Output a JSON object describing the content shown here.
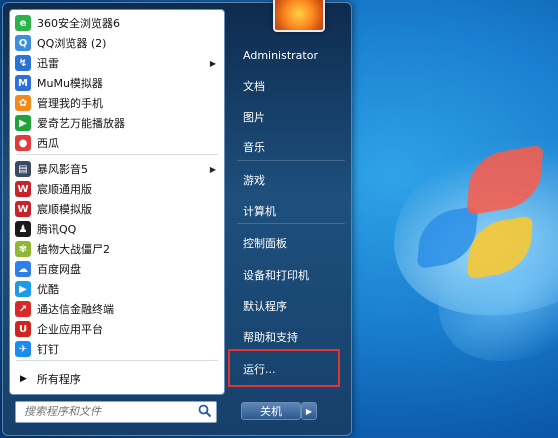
{
  "programs": [
    {
      "label": "360安全浏览器6",
      "icon": "360-browser-icon",
      "color": "#2db34a",
      "glyph": "e",
      "has_submenu": false
    },
    {
      "label": "QQ浏览器 (2)",
      "icon": "qq-browser-icon",
      "color": "#3b8de0",
      "glyph": "Q",
      "has_submenu": false
    },
    {
      "label": "迅雷",
      "icon": "xunlei-icon",
      "color": "#2a73d6",
      "glyph": "↯",
      "has_submenu": true
    },
    {
      "label": "MuMu模拟器",
      "icon": "mumu-icon",
      "color": "#2f6fd8",
      "glyph": "M",
      "has_submenu": false
    },
    {
      "label": "管理我的手机",
      "icon": "phone-manager-icon",
      "color": "#f08a1c",
      "glyph": "✿",
      "has_submenu": false
    },
    {
      "label": "爱奇艺万能播放器",
      "icon": "iqiyi-player-icon",
      "color": "#20a33a",
      "glyph": "▶",
      "has_submenu": false
    },
    {
      "label": "西瓜",
      "icon": "xigua-icon",
      "color": "#e23b3b",
      "glyph": "●",
      "has_submenu": false
    },
    {
      "label": "暴风影音5",
      "icon": "baofeng-icon",
      "color": "#3a4a64",
      "glyph": "▤",
      "has_submenu": true
    },
    {
      "label": "宸顺通用版",
      "icon": "chenshun-general-icon",
      "color": "#c8222b",
      "glyph": "W",
      "has_submenu": false
    },
    {
      "label": "宸顺模拟版",
      "icon": "chenshun-sim-icon",
      "color": "#c8222b",
      "glyph": "W",
      "has_submenu": false
    },
    {
      "label": "腾讯QQ",
      "icon": "qq-penguin-icon",
      "color": "#1a1a1a",
      "glyph": "♟",
      "has_submenu": false
    },
    {
      "label": "植物大战僵尸2",
      "icon": "pvz-icon",
      "color": "#8fb832",
      "glyph": "✾",
      "has_submenu": false
    },
    {
      "label": "百度网盘",
      "icon": "baidu-pan-icon",
      "color": "#2e7fe8",
      "glyph": "☁",
      "has_submenu": false
    },
    {
      "label": "优酷",
      "icon": "youku-icon",
      "color": "#1e9be8",
      "glyph": "▶",
      "has_submenu": false
    },
    {
      "label": "通达信金融终端",
      "icon": "tdx-icon",
      "color": "#d92a2a",
      "glyph": "↗",
      "has_submenu": false
    },
    {
      "label": "企业应用平台",
      "icon": "enterprise-app-icon",
      "color": "#d0241e",
      "glyph": "U",
      "has_submenu": false
    },
    {
      "label": "钉钉",
      "icon": "dingtalk-icon",
      "color": "#1a8cf0",
      "glyph": "✈",
      "has_submenu": false
    }
  ],
  "all_programs_label": "所有程序",
  "search_placeholder": "搜索程序和文件",
  "right_items": [
    {
      "label": "Administrator",
      "name": "user-name"
    },
    {
      "label": "文档",
      "name": "documents"
    },
    {
      "label": "图片",
      "name": "pictures"
    },
    {
      "label": "音乐",
      "name": "music"
    },
    {
      "label": "游戏",
      "name": "games"
    },
    {
      "label": "计算机",
      "name": "computer"
    },
    {
      "label": "控制面板",
      "name": "control-panel"
    },
    {
      "label": "设备和打印机",
      "name": "devices-printers"
    },
    {
      "label": "默认程序",
      "name": "default-programs"
    },
    {
      "label": "帮助和支持",
      "name": "help-support"
    },
    {
      "label": "运行...",
      "name": "run"
    }
  ],
  "shutdown_label": "关机",
  "colors": {
    "highlight": "#e53333",
    "menu_bg": "#16406a"
  }
}
